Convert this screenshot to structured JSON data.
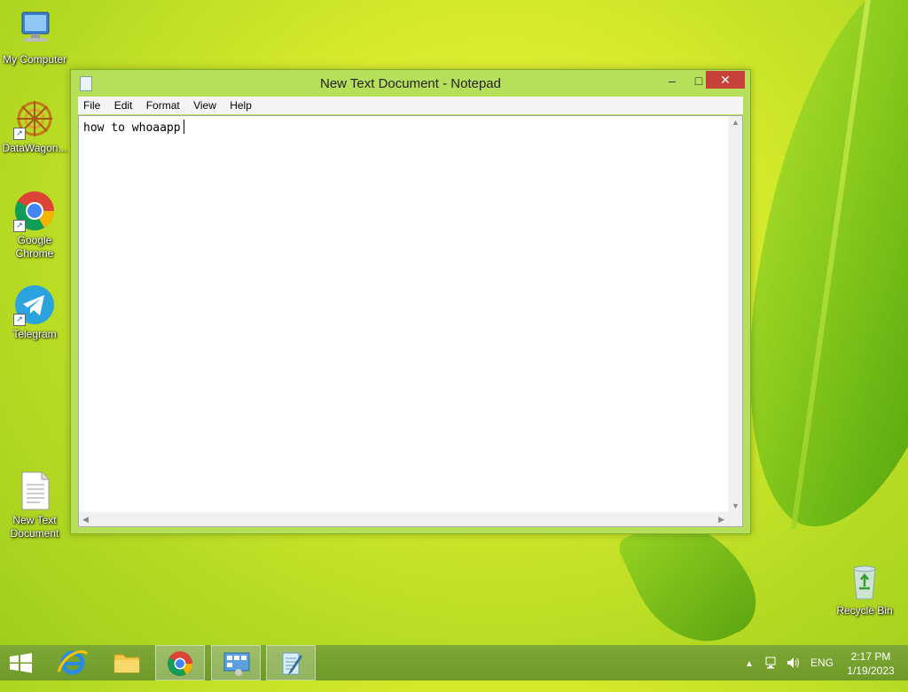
{
  "desktop": {
    "icons": [
      {
        "label": "My Computer"
      },
      {
        "label": "DataWagon..."
      },
      {
        "label": "Google Chrome"
      },
      {
        "label": "Telegram"
      },
      {
        "label": "New Text Document"
      },
      {
        "label": "Recycle Bin"
      }
    ]
  },
  "window": {
    "title": "New Text Document - Notepad",
    "minimize_glyph": "–",
    "maximize_glyph": "□",
    "close_glyph": "✕",
    "menu": [
      "File",
      "Edit",
      "Format",
      "View",
      "Help"
    ],
    "content": "how to whoaapp"
  },
  "taskbar": {
    "language": "ENG",
    "time": "2:17 PM",
    "date": "1/19/2023"
  },
  "colors": {
    "close_button": "#c7413b",
    "window_frame": "#b6e05a",
    "taskbar": "#7ea834"
  }
}
